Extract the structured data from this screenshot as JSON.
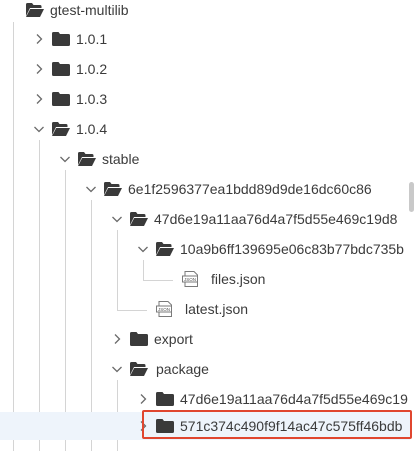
{
  "tree": {
    "root_label": "gtest-multilib",
    "v101_label": "1.0.1",
    "v102_label": "1.0.2",
    "v103_label": "1.0.3",
    "v104_label": "1.0.4",
    "stable_label": "stable",
    "rev_label": "6e1f2596377ea1bdd89d9de16dc60c86",
    "pkg_hash_label": "47d6e19a11aa76d4a7f5d55e469c19d8",
    "pkg_rev_label": "10a9b6ff139695e06c83b77bdc735b",
    "files_json_label": "files.json",
    "latest_json_label": "latest.json",
    "export_label": "export",
    "package_label": "package",
    "package_hash_label": "47d6e19a11aa76d4a7f5d55e469c19",
    "selected_label": "571c374c490f9f14ac47c575ff46bdb"
  },
  "icons": {
    "folder": "folder-icon",
    "folder_open": "folder-open-icon",
    "json": "json-file-icon",
    "chevron_right": "chevron-right-icon",
    "chevron_down": "chevron-down-icon"
  },
  "colors": {
    "folder": "#3a3a3a",
    "highlight_border": "#e0462f",
    "selected_row": "#eef4fb",
    "text": "#3b3b3b"
  }
}
